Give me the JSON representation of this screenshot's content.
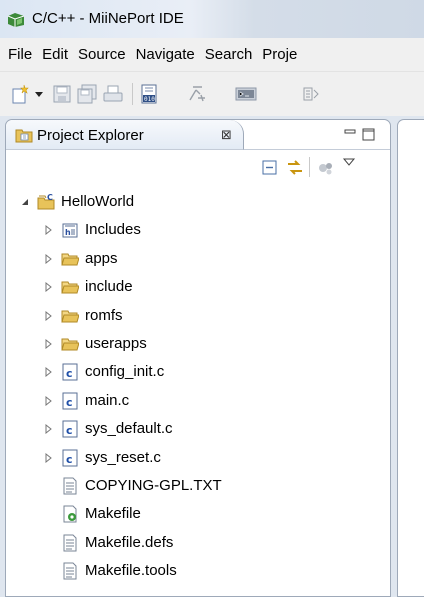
{
  "window": {
    "title": "C/C++ - MiiNePort IDE",
    "app_icon": "cdt-icon"
  },
  "menubar": {
    "items": [
      "File",
      "Edit",
      "Source",
      "Navigate",
      "Search",
      "Proje"
    ]
  },
  "toolbar": {
    "icons": [
      "new-wizard-icon",
      "dropdown-arrow-icon",
      "save-icon",
      "save-all-icon",
      "print-icon",
      "build-binary-icon",
      "debug-config-icon",
      "terminal-icon",
      "settings-icon"
    ]
  },
  "project_explorer": {
    "tab_label": "Project Explorer",
    "close_glyph": "⊠",
    "view_toolbar": [
      "collapse-all-icon",
      "link-with-editor-icon",
      "filter-icon",
      "view-menu-icon"
    ],
    "tree": [
      {
        "label": "HelloWorld",
        "icon": "c-project-icon",
        "level": 0,
        "expanded": true
      },
      {
        "label": "Includes",
        "icon": "includes-icon",
        "level": 1,
        "expanded": false
      },
      {
        "label": "apps",
        "icon": "folder-icon",
        "level": 1,
        "expanded": false
      },
      {
        "label": "include",
        "icon": "folder-icon",
        "level": 1,
        "expanded": false
      },
      {
        "label": "romfs",
        "icon": "folder-icon",
        "level": 1,
        "expanded": false
      },
      {
        "label": "userapps",
        "icon": "folder-icon",
        "level": 1,
        "expanded": false
      },
      {
        "label": "config_init.c",
        "icon": "c-file-icon",
        "level": 1,
        "expanded": false
      },
      {
        "label": "main.c",
        "icon": "c-file-icon",
        "level": 1,
        "expanded": false
      },
      {
        "label": "sys_default.c",
        "icon": "c-file-icon",
        "level": 1,
        "expanded": false
      },
      {
        "label": "sys_reset.c",
        "icon": "c-file-icon",
        "level": 1,
        "expanded": false
      },
      {
        "label": "COPYING-GPL.TXT",
        "icon": "text-file-icon",
        "level": 1,
        "leaf": true
      },
      {
        "label": "Makefile",
        "icon": "makefile-icon",
        "level": 1,
        "leaf": true
      },
      {
        "label": "Makefile.defs",
        "icon": "text-file-icon",
        "level": 1,
        "leaf": true
      },
      {
        "label": "Makefile.tools",
        "icon": "text-file-icon",
        "level": 1,
        "leaf": true
      }
    ]
  },
  "colors": {
    "titlebar": "#dbe6f3",
    "folder": "#e8c35a",
    "c_file": "#1f4fa8",
    "selection_border": "#9ea9b9"
  }
}
